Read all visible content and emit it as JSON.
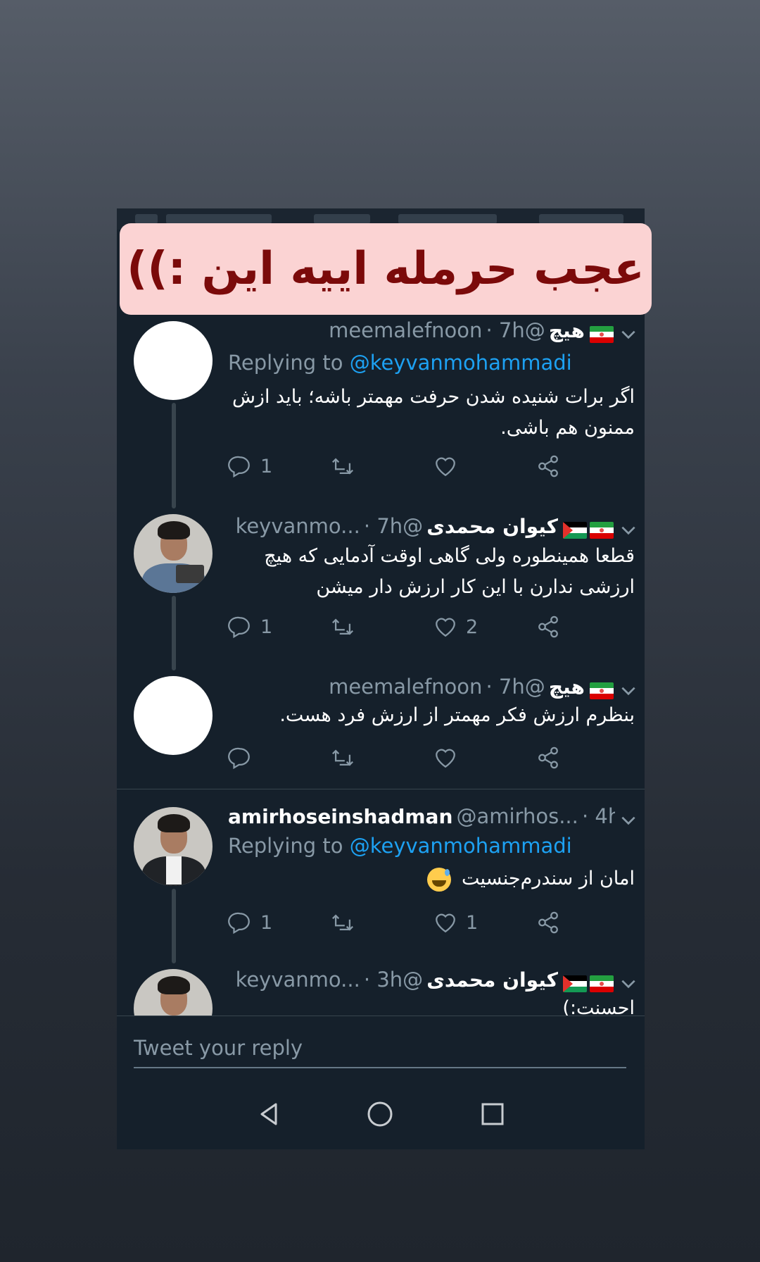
{
  "banner": {
    "text": "عجب حرمله اییه این :))"
  },
  "tweets": [
    {
      "name": "هیچ",
      "handle": "@meemalefnoon",
      "time": "· 7h",
      "replying_prefix": "Replying to",
      "replying_to": "@keyvanmohammadi",
      "text": "اگر برات شنیده شدن حرفت مهمتر باشه؛ باید ازش ممنون هم باشی.",
      "reply_count": "1",
      "retweet_count": "",
      "like_count": ""
    },
    {
      "name": "کیوان محمدی",
      "handle": "@keyvanmo...",
      "time": "· 7h",
      "text": "قطعا همینطوره ولی گاهی اوقت آدمایی که هیچ ارزشی ندارن با این کار ارزش دار میشن",
      "reply_count": "1",
      "retweet_count": "",
      "like_count": "2"
    },
    {
      "name": "هیچ",
      "handle": "@meemalefnoon",
      "time": "· 7h",
      "text": "بنظرم ارزش فکر مهمتر از ارزش فرد هست.",
      "reply_count": "",
      "retweet_count": "",
      "like_count": ""
    },
    {
      "name": "amirhoseinshadman",
      "handle": "@amirhos...",
      "time": "· 4h",
      "replying_prefix": "Replying to",
      "replying_to": "@keyvanmohammadi",
      "text": "امان از سندرم‌جنسیت",
      "emoji": "sweat-smile-emoji",
      "reply_count": "1",
      "retweet_count": "",
      "like_count": "1"
    },
    {
      "name": "کیوان محمدی",
      "handle": "@keyvanmo...",
      "time": "· 3h",
      "text": "احسنت:)"
    }
  ],
  "reply_bar": {
    "placeholder": "Tweet your reply"
  },
  "icons": {
    "reply": "reply-icon",
    "retweet": "retweet-icon",
    "like": "heart-icon",
    "share": "share-icon",
    "caret": "chevron-down-icon",
    "nav_back": "back-triangle-icon",
    "nav_home": "home-circle-icon",
    "nav_recents": "recents-square-icon"
  },
  "colors": {
    "background": "#15202b",
    "text_secondary": "#8899a6",
    "link": "#1da1f2",
    "banner_bg": "#fbd3d3",
    "banner_text": "#7b0a0a"
  }
}
